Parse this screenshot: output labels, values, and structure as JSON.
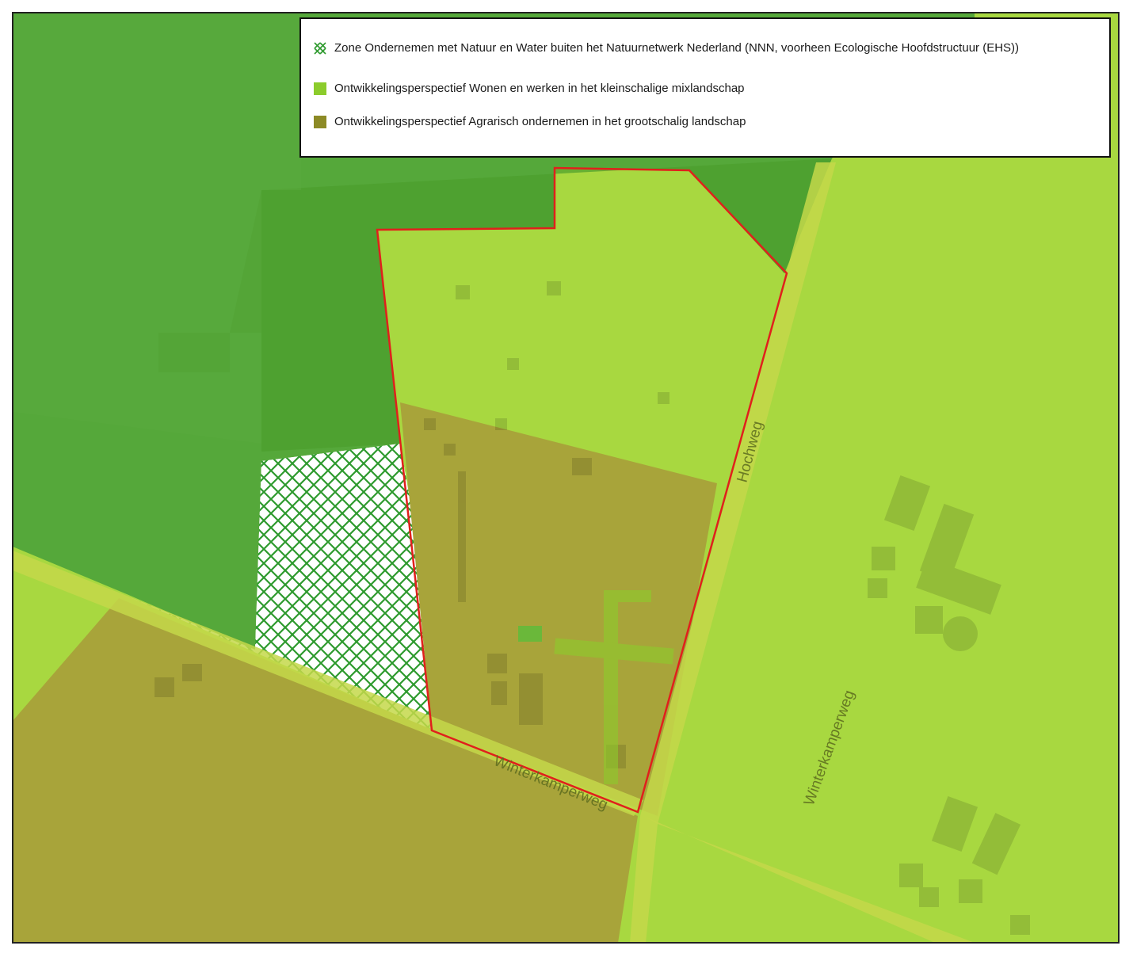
{
  "legend": {
    "items": [
      {
        "label": "Zone Ondernemen met Natuur en Water buiten het Natuurnetwerk Nederland (NNN, voorheen Ecologische Hoofdstructuur (EHS))",
        "swatch": "crosshatch",
        "color": "#2e9a2e"
      },
      {
        "label": "Ontwikkelingsperspectief Wonen en werken in het kleinschalige mixlandschap",
        "swatch": "solid",
        "color": "#8ccc2c"
      },
      {
        "label": "Ontwikkelingsperspectief Agrarisch ondernemen in het grootschalig landschap",
        "swatch": "solid",
        "color": "#8c8a26"
      }
    ]
  },
  "map": {
    "road_labels": {
      "hochweg": "Hochweg",
      "winterkamperweg_south": "Winterkamperweg",
      "winterkamperweg_east": "Winterkamperweg"
    },
    "colors": {
      "nnn_green": "#55a83a",
      "mixlandschap": "#a8d840",
      "agrarisch": "#a8a43a",
      "plan_boundary": "#e0201c",
      "road": "#c4d84a"
    }
  }
}
